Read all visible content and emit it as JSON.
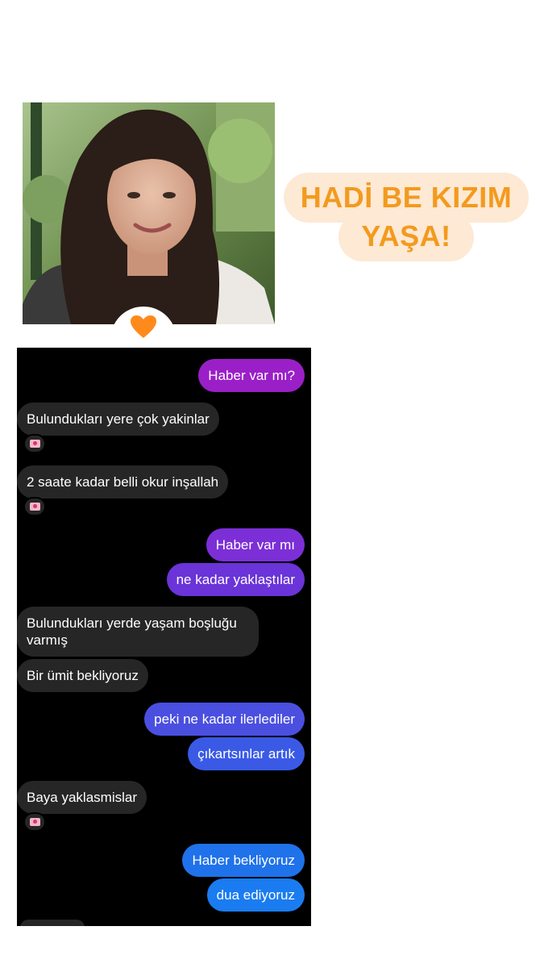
{
  "sticker": {
    "line1": "HADİ BE KIZIM",
    "line2": "YAŞA!",
    "text_color": "#f39a1e",
    "bg_color": "#fde9d4"
  },
  "reaction": {
    "icon": "orange-heart-icon",
    "color": "#ff8a1c"
  },
  "messages": [
    {
      "side": "out",
      "text": "Haber var mı?",
      "color": "#9b1fc7"
    },
    {
      "side": "in",
      "text": "Bulundukları yere çok yakinlar",
      "reaction": "love-letter-icon"
    },
    {
      "side": "in",
      "text": "2 saate kadar belli okur inşallah",
      "reaction": "love-letter-icon"
    },
    {
      "side": "out",
      "text": "Haber var mı",
      "color": "#7c2fd6"
    },
    {
      "side": "out",
      "text": "ne kadar yaklaştılar",
      "color": "#6a34d8"
    },
    {
      "side": "in",
      "text": "Bulundukları yerde yaşam boşluğu varmış"
    },
    {
      "side": "in",
      "text": "Bir ümit bekliyoruz"
    },
    {
      "side": "out",
      "text": "peki ne kadar ilerlediler",
      "color": "#4a4fe0"
    },
    {
      "side": "out",
      "text": "çıkartsınlar artık",
      "color": "#3a5ae6"
    },
    {
      "side": "in",
      "text": "Baya yaklasmislar",
      "reaction": "love-letter-icon"
    },
    {
      "side": "out",
      "text": "Haber bekliyoruz",
      "color": "#1f72ea"
    },
    {
      "side": "out",
      "text": "dua ediyoruz",
      "color": "#1a7cf0"
    }
  ]
}
